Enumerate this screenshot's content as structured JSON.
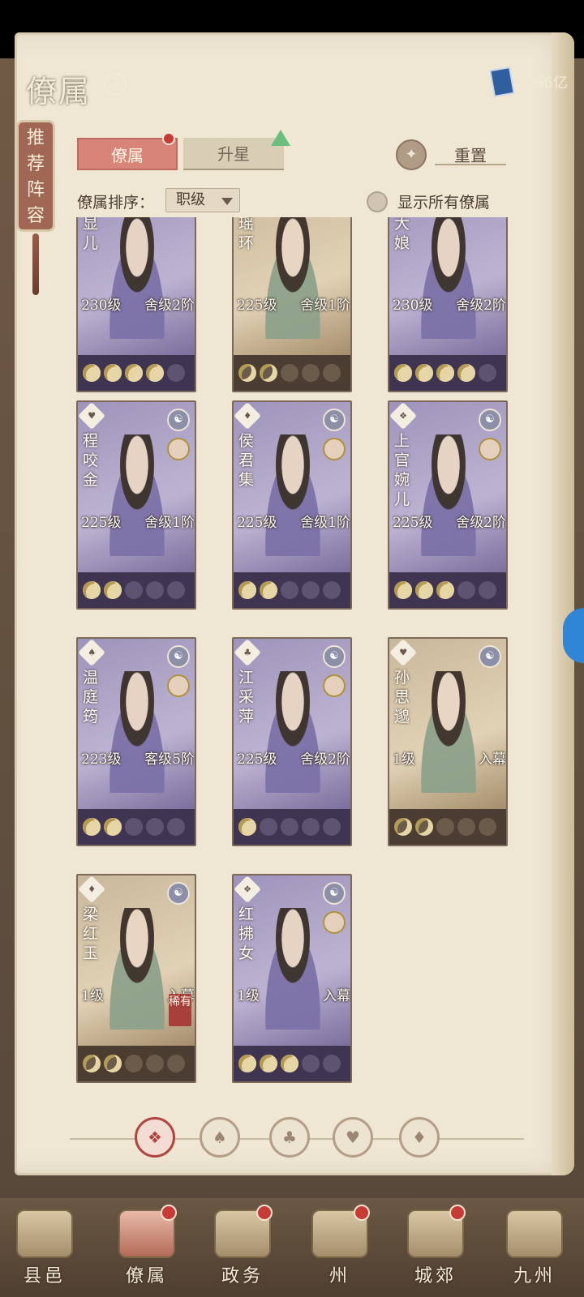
{
  "header": {
    "title": "僚属",
    "currency_value": "3.56亿"
  },
  "recommend_banner": "推荐阵容",
  "tabs": [
    {
      "label": "僚属"
    },
    {
      "label": "升星"
    }
  ],
  "reset_label": "重置",
  "sort": {
    "label": "僚属排序：",
    "selected": "职级"
  },
  "show_all_label": "显示所有僚属",
  "cards": [
    {
      "name": "显儿",
      "level": "230级",
      "rank": "舍级2阶",
      "stars": 4,
      "theme": "purple"
    },
    {
      "name": "瑶环",
      "level": "225级",
      "rank": "舍级1阶",
      "stars": 2,
      "theme": "gold"
    },
    {
      "name": "大娘",
      "level": "230级",
      "rank": "舍级2阶",
      "stars": 4,
      "theme": "purple"
    },
    {
      "name": "程咬金",
      "level": "225级",
      "rank": "舍级1阶",
      "stars": 2,
      "theme": "purple"
    },
    {
      "name": "侯君集",
      "level": "225级",
      "rank": "舍级1阶",
      "stars": 2,
      "theme": "purple"
    },
    {
      "name": "上官婉儿",
      "level": "225级",
      "rank": "舍级2阶",
      "stars": 3,
      "theme": "purple"
    },
    {
      "name": "温庭筠",
      "level": "223级",
      "rank": "客级5阶",
      "stars": 2,
      "theme": "purple"
    },
    {
      "name": "江采萍",
      "level": "225级",
      "rank": "舍级2阶",
      "stars": 1,
      "theme": "purple"
    },
    {
      "name": "孙思邈",
      "level": "1级",
      "rank": "入幕",
      "stars": 2,
      "theme": "gold"
    },
    {
      "name": "梁红玉",
      "level": "1级",
      "rank": "入幕",
      "stars": 2,
      "theme": "gold",
      "badge": "稀有"
    },
    {
      "name": "红拂女",
      "level": "1级",
      "rank": "入幕",
      "stars": 3,
      "theme": "purple"
    }
  ],
  "bottom_nav": [
    {
      "label": "县邑",
      "dot": false
    },
    {
      "label": "僚属",
      "dot": true
    },
    {
      "label": "政务",
      "dot": true
    },
    {
      "label": "州",
      "dot": true
    },
    {
      "label": "城郊",
      "dot": true
    },
    {
      "label": "九州",
      "dot": false
    }
  ]
}
